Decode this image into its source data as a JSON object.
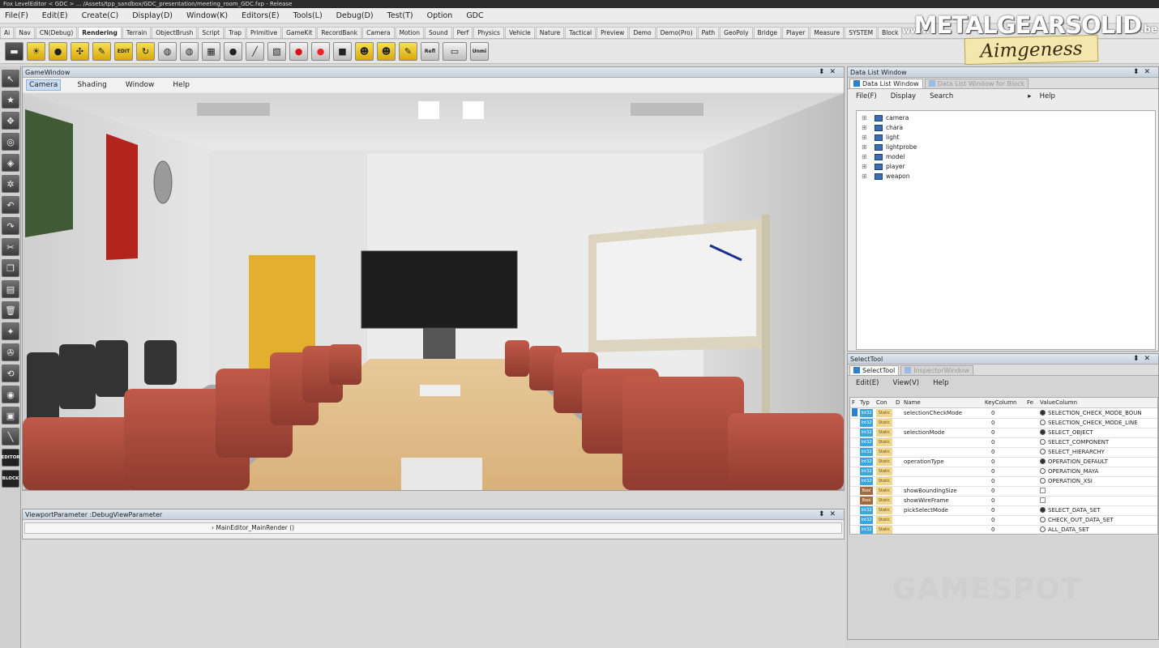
{
  "window_title": "Fox LevelEditor < GDC > ... /Assets/tpp_sandbox/GDC_presentation/meeting_room_GDC.fxp - Release",
  "menu": [
    "File(F)",
    "Edit(E)",
    "Create(C)",
    "Display(D)",
    "Window(K)",
    "Editors(E)",
    "Tools(L)",
    "Debug(D)",
    "Test(T)",
    "Option",
    "GDC"
  ],
  "tabs": [
    "Ai",
    "Nav",
    "CN(Debug)",
    "Rendering",
    "Terrain",
    "ObjectBrush",
    "Script",
    "Trap",
    "Primitive",
    "GameKit",
    "RecordBank",
    "Camera",
    "Motion",
    "Sound",
    "Perf",
    "Physics",
    "Vehicle",
    "Nature",
    "Tactical",
    "Preview",
    "Demo",
    "Demo(Pro)",
    "Path",
    "GeoPoly",
    "Bridge",
    "Player",
    "Measure",
    "SYSTEM",
    "Block"
  ],
  "active_tab": "Rendering",
  "toolbar_labels": {
    "edit": "EDIT",
    "refl": "Refl",
    "unmi": "Unmi"
  },
  "logo": {
    "www": "www.",
    "main": "METALGEARSOLID",
    "tld": ".be",
    "badge": "Aimgeness"
  },
  "left_tools": {
    "editor": "EDITOR",
    "block": "BLOCK"
  },
  "game_window": {
    "title": "GameWindow",
    "menu": [
      "Camera",
      "Shading",
      "Window",
      "Help"
    ],
    "active_menu": "Camera"
  },
  "viewport_param": {
    "title": "ViewportParameter :DebugViewParameter",
    "row": "MainEditor_MainRender ()"
  },
  "data_list": {
    "title": "Data List Window",
    "tabs": [
      "Data List Window",
      "Data List Window for Block"
    ],
    "menu": [
      "File(F)",
      "Display",
      "Search",
      "Help"
    ],
    "nodes": [
      "camera",
      "chara",
      "light",
      "lightprobe",
      "model",
      "player",
      "weapon"
    ]
  },
  "select_tool": {
    "title": "SelectTool",
    "tabs": [
      "SelectTool",
      "InspectorWindow"
    ],
    "menu": [
      "Edit(E)",
      "View(V)",
      "Help"
    ],
    "columns": [
      "F",
      "Typ",
      "Con",
      "D",
      "Name",
      "KeyColumn",
      "Fe",
      "ValueColumn"
    ],
    "rows": [
      {
        "type": "Int32",
        "con": "Static",
        "name": "selectionCheckMode",
        "key": "0",
        "value": "SELECTION_CHECK_MODE_BOUN",
        "radio": true,
        "on": true,
        "fsel": true
      },
      {
        "type": "Int32",
        "con": "Static",
        "name": "",
        "key": "0",
        "value": "SELECTION_CHECK_MODE_LINE",
        "radio": true,
        "on": false
      },
      {
        "type": "Int32",
        "con": "Static",
        "name": "selectionMode",
        "key": "0",
        "value": "SELECT_OBJECT",
        "radio": true,
        "on": true
      },
      {
        "type": "Int32",
        "con": "Static",
        "name": "",
        "key": "0",
        "value": "SELECT_COMPONENT",
        "radio": true,
        "on": false
      },
      {
        "type": "Int32",
        "con": "Static",
        "name": "",
        "key": "0",
        "value": "SELECT_HIERARCHY",
        "radio": true,
        "on": false
      },
      {
        "type": "Int32",
        "con": "Static",
        "name": "operationType",
        "key": "0",
        "value": "OPERATION_DEFAULT",
        "radio": true,
        "on": true
      },
      {
        "type": "Int32",
        "con": "Static",
        "name": "",
        "key": "0",
        "value": "OPERATION_MAYA",
        "radio": true,
        "on": false
      },
      {
        "type": "Int32",
        "con": "Static",
        "name": "",
        "key": "0",
        "value": "OPERATION_XSI",
        "radio": true,
        "on": false
      },
      {
        "type": "Bool",
        "con": "Static",
        "name": "showBoundingSize",
        "key": "0",
        "value": "",
        "check": true
      },
      {
        "type": "Bool",
        "con": "Static",
        "name": "showWireFrame",
        "key": "0",
        "value": "",
        "check": true
      },
      {
        "type": "Int32",
        "con": "Static",
        "name": "pickSelectMode",
        "key": "0",
        "value": "SELECT_DATA_SET",
        "radio": true,
        "on": true
      },
      {
        "type": "Int32",
        "con": "Static",
        "name": "",
        "key": "0",
        "value": "CHECK_OUT_DATA_SET",
        "radio": true,
        "on": false
      },
      {
        "type": "Int32",
        "con": "Static",
        "name": "",
        "key": "0",
        "value": "ALL_DATA_SET",
        "radio": true,
        "on": false
      }
    ]
  },
  "watermark": "GAMESPOT"
}
